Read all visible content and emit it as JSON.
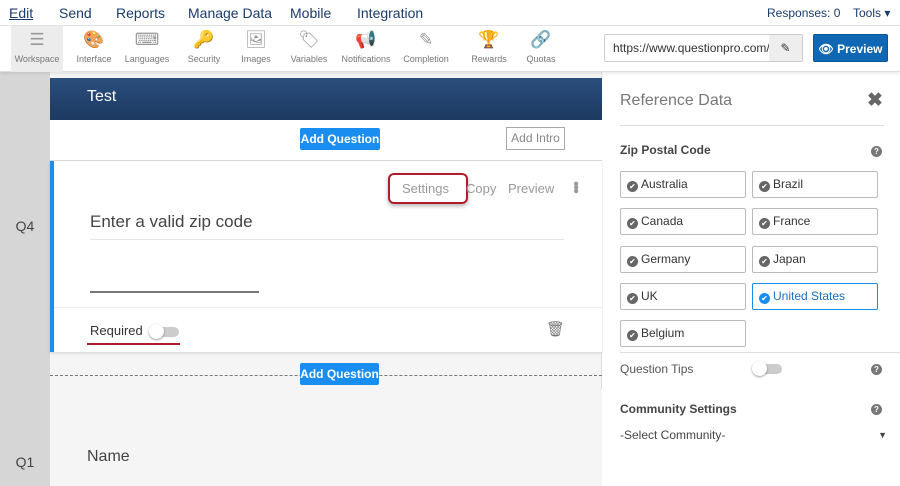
{
  "topnav": {
    "items": [
      "Edit",
      "Send",
      "Reports",
      "Manage Data",
      "Mobile",
      "Integration"
    ],
    "responses": "Responses: 0",
    "tools": "Tools"
  },
  "toolbar": {
    "items": [
      {
        "label": "Workspace",
        "icon": "☰"
      },
      {
        "label": "Interface",
        "icon": "🎨"
      },
      {
        "label": "Languages",
        "icon": "⌨"
      },
      {
        "label": "Security",
        "icon": "🔑"
      },
      {
        "label": "Images",
        "icon": "🖼"
      },
      {
        "label": "Variables",
        "icon": "🏷"
      },
      {
        "label": "Notifications",
        "icon": "📢"
      },
      {
        "label": "Completion",
        "icon": "✎"
      },
      {
        "label": "Rewards",
        "icon": "🏆"
      },
      {
        "label": "Quotas",
        "icon": "🔗"
      }
    ],
    "url": "https://www.questionpro.com/",
    "preview": "Preview"
  },
  "survey": {
    "title": "Test",
    "add_question": "Add Question",
    "add_intro": "Add Intro",
    "q4": {
      "num": "Q4",
      "text": "Enter a valid zip code",
      "settings": "Settings",
      "copy": "Copy",
      "preview": "Preview",
      "required": "Required"
    },
    "q1": {
      "num": "Q1",
      "text": "Name"
    }
  },
  "panel": {
    "title": "Reference Data",
    "section": "Zip Postal Code",
    "options": [
      "Australia",
      "Brazil",
      "Canada",
      "France",
      "Germany",
      "Japan",
      "UK",
      "United States",
      "Belgium"
    ],
    "selected": "United States",
    "question_tips": "Question Tips",
    "community_settings": "Community Settings",
    "community_select": "-Select Community-"
  }
}
